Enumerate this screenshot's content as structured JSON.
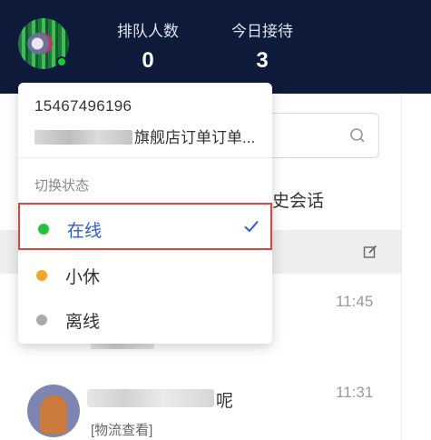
{
  "header": {
    "queue_label": "排队人数",
    "queue_count": "0",
    "today_label": "今日接待",
    "today_count": "3"
  },
  "background": {
    "history_tab_partial": "史会话",
    "list": [
      {
        "time": "11:45"
      },
      {
        "name_suffix": "呢",
        "time": "11:31",
        "message": "[物流查看]"
      }
    ]
  },
  "profile_menu": {
    "phone": "15467496196",
    "shop_name_visible": "旗舰店订单订单...",
    "section_label": "切换状态",
    "statuses": [
      {
        "label": "在线",
        "color": "#22c33d",
        "selected": true
      },
      {
        "label": "小休",
        "color": "#f7a325",
        "selected": false
      },
      {
        "label": "离线",
        "color": "#aaaaaa",
        "selected": false
      }
    ]
  },
  "colors": {
    "header_bg": "#0e1a3a",
    "selected_text": "#2f5bd6",
    "highlight_border": "#e0443c"
  }
}
